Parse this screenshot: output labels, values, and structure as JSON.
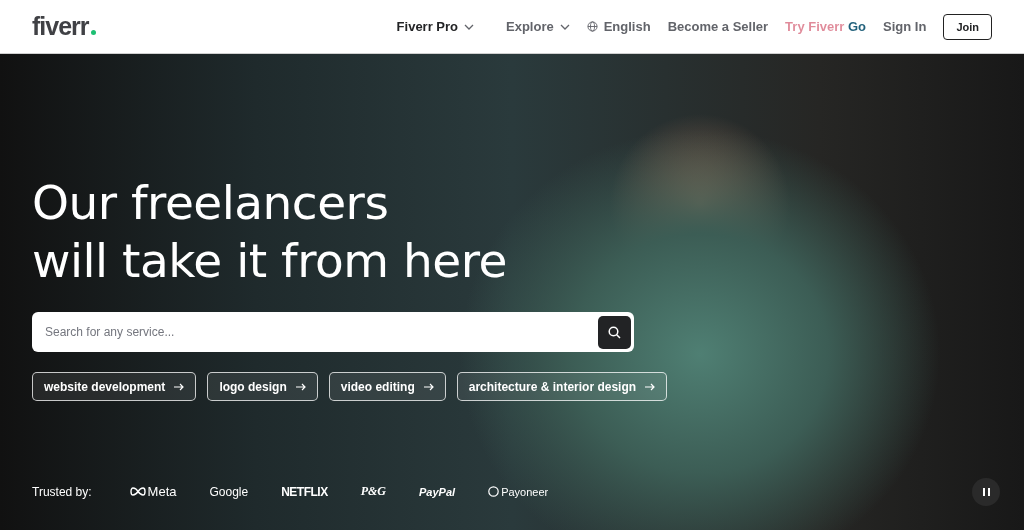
{
  "header": {
    "logo": "fiverr",
    "nav": [
      {
        "label": "Fiverr Pro",
        "kind": "dropdown"
      },
      {
        "label": "Explore",
        "kind": "dropdown"
      },
      {
        "label": "English",
        "kind": "language"
      },
      {
        "label": "Become a Seller",
        "kind": "link"
      },
      {
        "label": "Try Fiverr Go",
        "kind": "promo"
      },
      {
        "label": "Sign In",
        "kind": "link"
      },
      {
        "label": "Join",
        "kind": "button"
      }
    ]
  },
  "hero": {
    "headline": [
      "Our freelancers",
      "will take it from here"
    ],
    "search": {
      "placeholder": "Search for any service..."
    },
    "suggestions": [
      "website development",
      "logo design",
      "video editing",
      "architecture & interior design"
    ],
    "trusted_label": "Trusted by:",
    "trusted_logos": [
      {
        "name": "Meta",
        "kind": "meta"
      },
      {
        "name": "Google",
        "kind": "google"
      },
      {
        "name": "NETFLIX",
        "kind": "netflix"
      },
      {
        "name": "P&G",
        "kind": "pg"
      },
      {
        "name": "PayPal",
        "kind": "paypal"
      },
      {
        "name": "Payoneer",
        "kind": "payoneer"
      }
    ]
  }
}
